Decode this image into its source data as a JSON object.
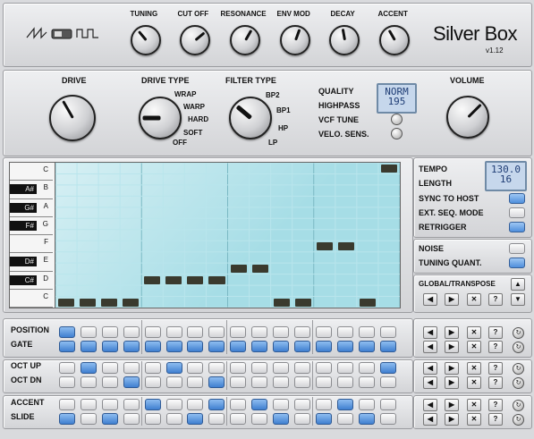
{
  "brand": {
    "title": "Silver Box",
    "version": "v1.12"
  },
  "top_knobs": [
    {
      "label": "TUNING",
      "angle": 140
    },
    {
      "label": "CUT OFF",
      "angle": 230
    },
    {
      "label": "RESONANCE",
      "angle": 210
    },
    {
      "label": "ENV MOD",
      "angle": 200
    },
    {
      "label": "DECAY",
      "angle": 170
    },
    {
      "label": "ACCENT",
      "angle": 150
    }
  ],
  "drive": {
    "label": "DRIVE",
    "angle": 150
  },
  "drive_type": {
    "label": "DRIVE TYPE",
    "options": [
      "WRAP",
      "WARP",
      "HARD",
      "SOFT",
      "OFF"
    ],
    "angle": 90
  },
  "filter_type": {
    "label": "FILTER TYPE",
    "options": [
      "BP2",
      "BP1",
      "HP",
      "LP"
    ],
    "angle": 130
  },
  "quality": {
    "label": "QUALITY",
    "value": "NORM"
  },
  "highpass": {
    "label": "HIGHPASS",
    "value": "195"
  },
  "vcf_tune": {
    "label": "VCF TUNE"
  },
  "velo_sens": {
    "label": "VELO. SENS."
  },
  "volume": {
    "label": "VOLUME",
    "angle": 225
  },
  "piano_keys": {
    "white": [
      "C",
      "B",
      "A",
      "G",
      "F",
      "E",
      "D",
      "C"
    ],
    "black": [
      "A#",
      "G#",
      "F#",
      "D#",
      "C#"
    ]
  },
  "notes": [
    0,
    0,
    0,
    0,
    2,
    2,
    2,
    2,
    3,
    3,
    0,
    0,
    5,
    5,
    0,
    12
  ],
  "note_active": [
    true,
    true,
    true,
    true,
    true,
    true,
    true,
    true,
    true,
    true,
    true,
    true,
    true,
    true,
    true,
    true
  ],
  "right_panel": {
    "tempo_label": "TEMPO",
    "tempo_value": "130.0",
    "length_label": "LENGTH",
    "length_value": "16",
    "sync_label": "SYNC TO HOST",
    "sync_on": true,
    "ext_label": "EXT. SEQ. MODE",
    "ext_on": false,
    "retrigger_label": "RETRIGGER",
    "retrigger_on": true,
    "noise_label": "NOISE",
    "noise_on": false,
    "tq_label": "TUNING QUANT.",
    "tq_on": true,
    "global_label": "GLOBAL/TRANSPOSE"
  },
  "seq_rows": [
    {
      "label": "POSITION",
      "steps": [
        1,
        0,
        0,
        0,
        0,
        0,
        0,
        0,
        0,
        0,
        0,
        0,
        0,
        0,
        0,
        0
      ]
    },
    {
      "label": "GATE",
      "steps": [
        1,
        1,
        1,
        1,
        1,
        1,
        1,
        1,
        1,
        1,
        1,
        1,
        1,
        1,
        1,
        1
      ]
    },
    {
      "label": "OCT UP",
      "steps": [
        0,
        1,
        0,
        0,
        0,
        1,
        0,
        0,
        0,
        0,
        0,
        0,
        0,
        0,
        0,
        1
      ]
    },
    {
      "label": "OCT DN",
      "steps": [
        0,
        0,
        0,
        1,
        0,
        0,
        0,
        1,
        0,
        0,
        0,
        0,
        0,
        0,
        0,
        0
      ]
    },
    {
      "label": "ACCENT",
      "steps": [
        0,
        0,
        0,
        0,
        1,
        0,
        0,
        1,
        0,
        1,
        0,
        0,
        0,
        1,
        0,
        0
      ]
    },
    {
      "label": "SLIDE",
      "steps": [
        1,
        0,
        1,
        0,
        0,
        0,
        1,
        0,
        0,
        0,
        1,
        0,
        1,
        0,
        1,
        0
      ]
    }
  ],
  "row_ctl_glyphs": {
    "left": "◀",
    "right": "▶",
    "clear": "✕",
    "random": "?",
    "dice": "↻"
  },
  "global_ctl_glyphs": {
    "up": "▲",
    "down": "▼"
  },
  "colors": {
    "step_on": "#4f8fdc",
    "note": "#3a3a2e",
    "grid_bg": "#a6dde6"
  }
}
